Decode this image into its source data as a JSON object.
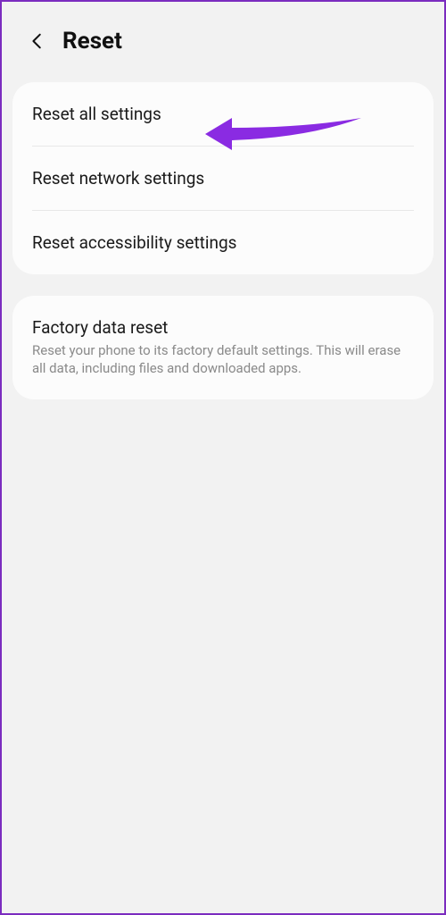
{
  "header": {
    "title": "Reset"
  },
  "card1": {
    "items": [
      {
        "label": "Reset all settings"
      },
      {
        "label": "Reset network settings"
      },
      {
        "label": "Reset accessibility settings"
      }
    ]
  },
  "card2": {
    "items": [
      {
        "label": "Factory data reset",
        "desc": "Reset your phone to its factory default settings. This will erase all data, including files and downloaded apps."
      }
    ]
  },
  "annotation": {
    "color": "#8a2be2"
  }
}
